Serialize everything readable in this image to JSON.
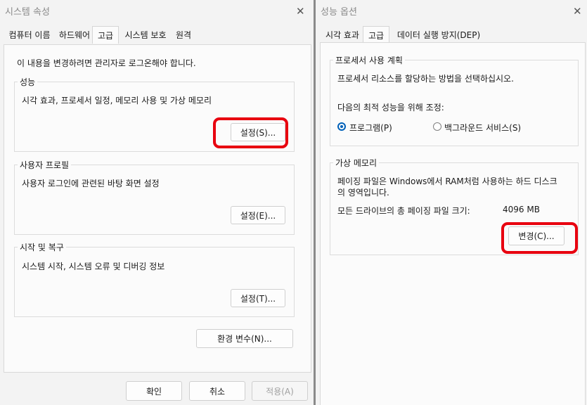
{
  "left": {
    "title": "시스템 속성",
    "tabs": [
      "컴퓨터 이름",
      "하드웨어",
      "고급",
      "시스템 보호",
      "원격"
    ],
    "admin_note": "이 내용을 변경하려면 관리자로 로그온해야 합니다.",
    "performance": {
      "title": "성능",
      "desc": "시각 효과, 프로세서 일정, 메모리 사용 및 가상 메모리",
      "button": "설정(S)..."
    },
    "profile": {
      "title": "사용자 프로필",
      "desc": "사용자 로그인에 관련된 바탕 화면 설정",
      "button": "설정(E)..."
    },
    "startup": {
      "title": "시작 및 복구",
      "desc": "시스템 시작, 시스템 오류 및 디버깅 정보",
      "button": "설정(T)..."
    },
    "env_button": "환경 변수(N)...",
    "ok": "확인",
    "cancel": "취소",
    "apply": "적용(A)"
  },
  "right": {
    "title": "성능 옵션",
    "tabs": [
      "시각 효과",
      "고급",
      "데이터 실행 방지(DEP)"
    ],
    "processor": {
      "title": "프로세서 사용 계획",
      "desc": "프로세서 리소스를 할당하는 방법을 선택하십시오.",
      "adjust": "다음의 최적 성능을 위해 조정:",
      "option_programs": "프로그램(P)",
      "option_background": "백그라운드 서비스(S)",
      "selected": "프로그램(P)"
    },
    "virtual": {
      "title": "가상 메모리",
      "desc_line1": "페이징 파일은 Windows에서 RAM처럼 사용하는 하드 디스크",
      "desc_line2": "의 영역입니다.",
      "total_label": "모든 드라이브의 총 페이징 파일 크기:",
      "total_value": "4096 MB",
      "button": "변경(C)..."
    }
  },
  "colors": {
    "highlight": "#e8000f",
    "radio_accent": "#0061b9"
  }
}
